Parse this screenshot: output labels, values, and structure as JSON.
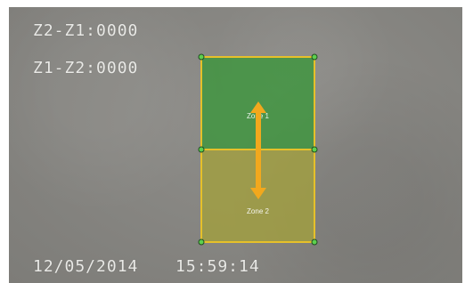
{
  "osd": {
    "counter_z2_z1": "Z2-Z1:0000",
    "counter_z1_z2": "Z1-Z2:0000",
    "date": "12/05/2014",
    "time": "15:59:14"
  },
  "zones": [
    {
      "label": "Zone 1",
      "color": "#3a963a"
    },
    {
      "label": "Zone 2",
      "color": "#a3a03c"
    }
  ],
  "colors": {
    "zone_border": "#e6c02a",
    "handle": "#5dd04f",
    "arrow": "#f2a81d"
  },
  "icons": {
    "direction": "double-arrow-vertical-icon"
  }
}
